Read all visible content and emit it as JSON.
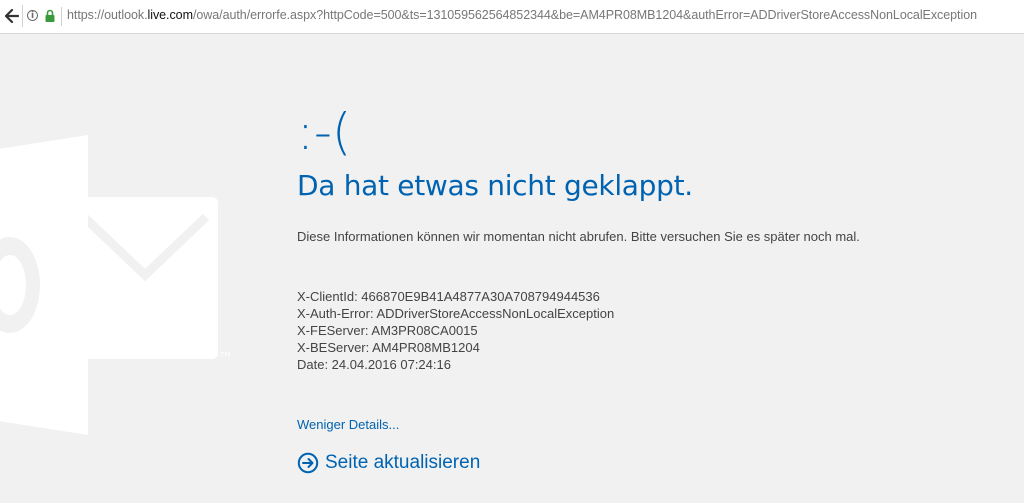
{
  "browser": {
    "url_prefix": "https://outlook.",
    "url_host": "live.com",
    "url_suffix": "/owa/auth/errorfe.aspx?httpCode=500&ts=131059562564852344&be=AM4PR08MB1204&authError=ADDriverStoreAccessNonLocalException",
    "info_glyph": "i"
  },
  "error": {
    "face": ":-(",
    "headline": "Da hat etwas nicht geklappt.",
    "message": "Diese Informationen können wir momentan nicht abrufen. Bitte versuchen Sie es später noch mal."
  },
  "details": {
    "client_id": "X-ClientId: 466870E9B41A4877A30A708794944536",
    "auth_error": "X-Auth-Error: ADDriverStoreAccessNonLocalException",
    "fe_server": "X-FEServer: AM3PR08CA0015",
    "be_server": "X-BEServer: AM4PR08MB1204",
    "date": "Date: 24.04.2016 07:24:16"
  },
  "actions": {
    "fewer_details": "Weniger Details...",
    "refresh": "Seite aktualisieren"
  },
  "colors": {
    "accent": "#0063b1",
    "background": "#f1f1f1",
    "text": "#444444"
  },
  "icons": {
    "back": "back-arrow-icon",
    "info": "info-icon",
    "lock": "lock-icon",
    "refresh": "circle-arrow-right-icon",
    "logo": "outlook-logo-icon"
  }
}
